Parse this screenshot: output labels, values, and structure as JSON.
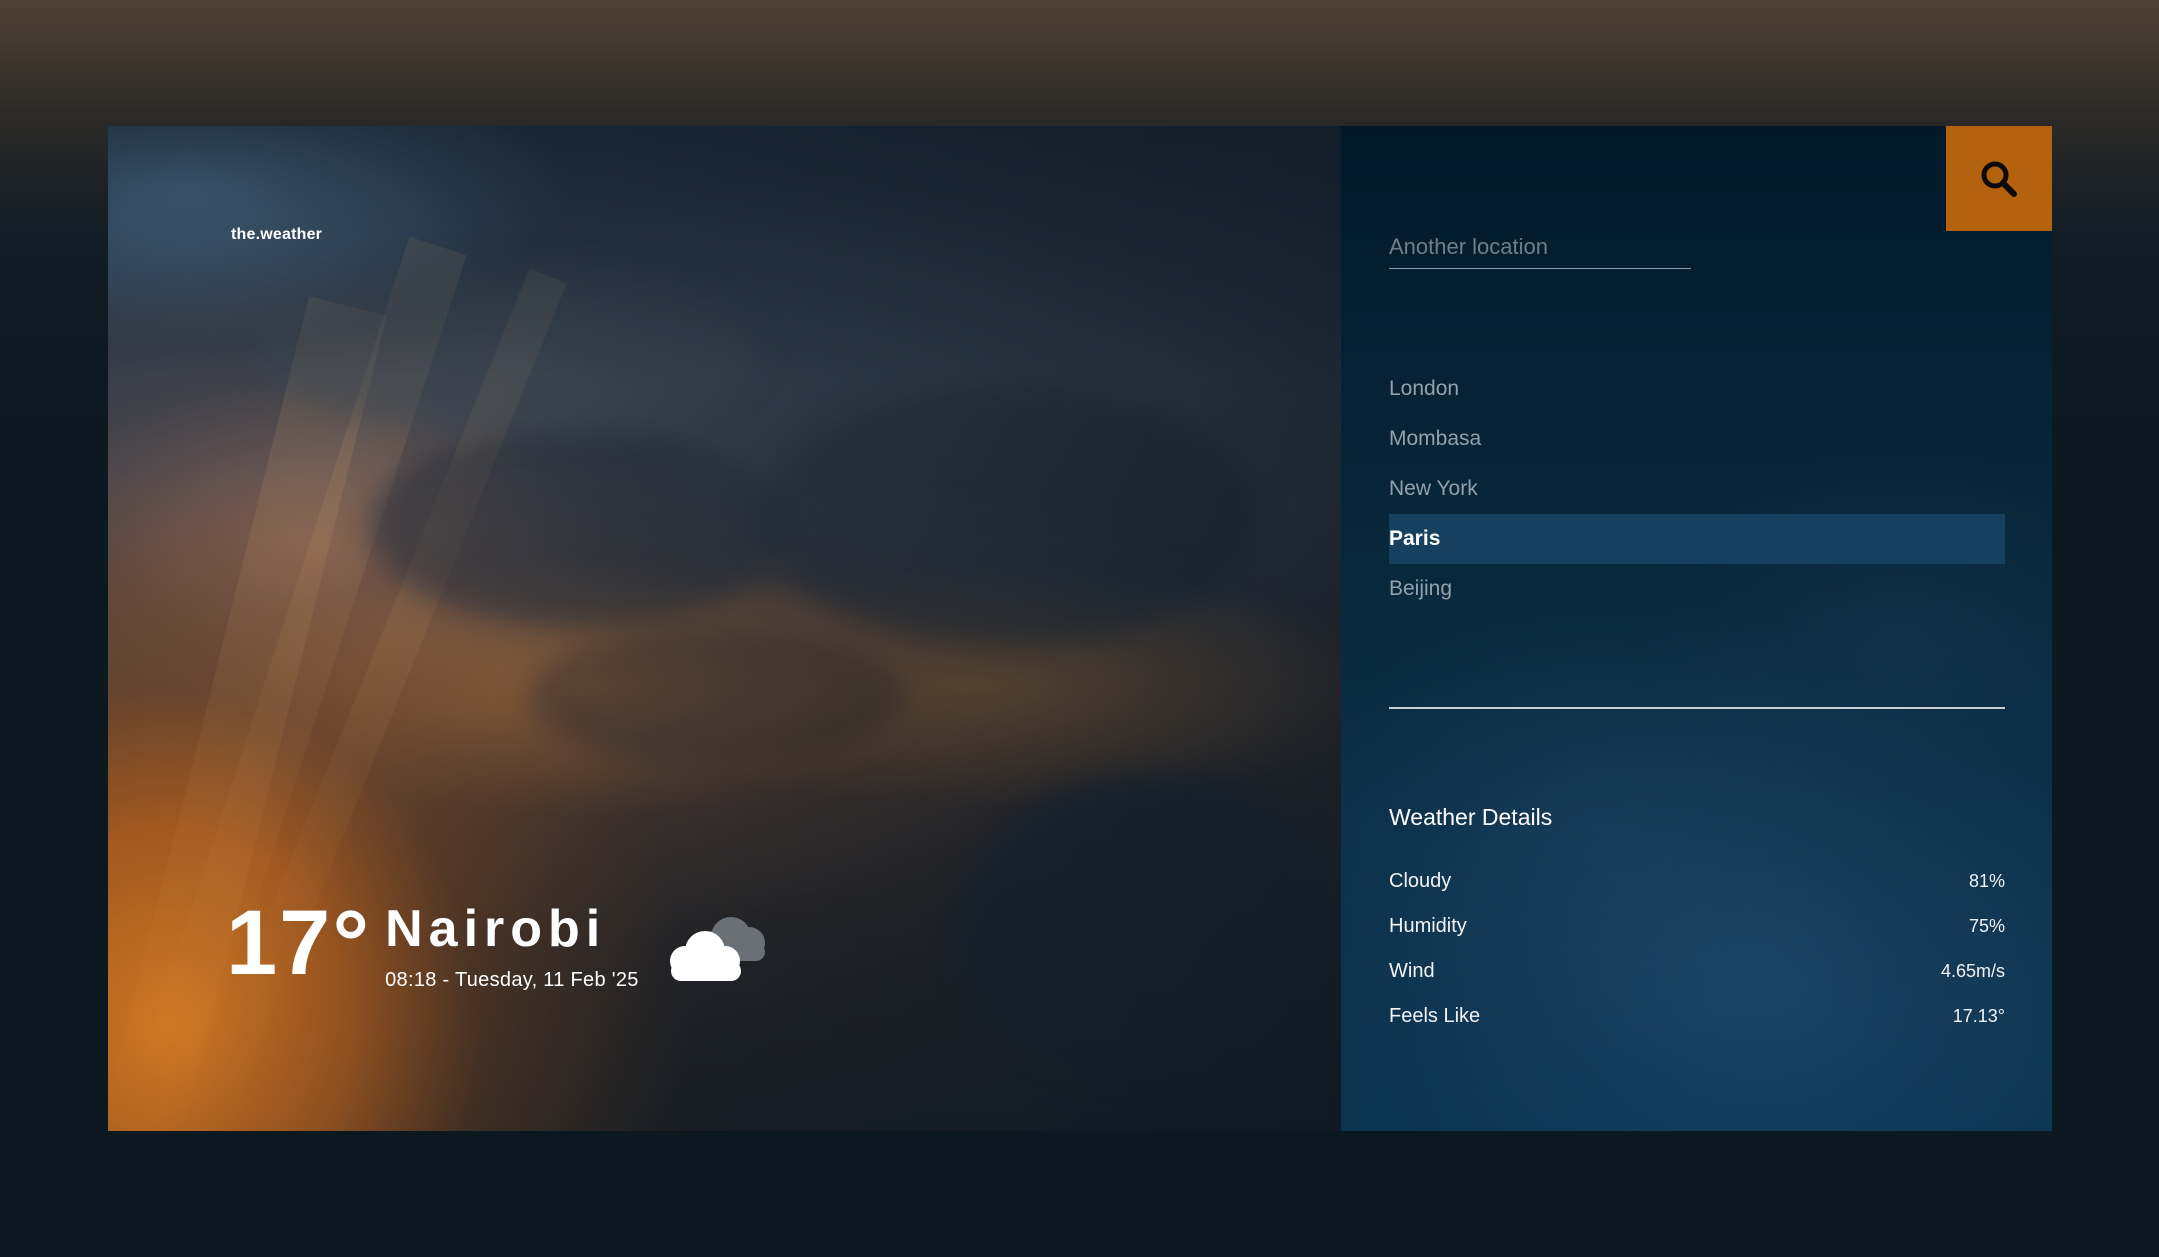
{
  "brand": "the.weather",
  "current": {
    "temperature": "17°",
    "city": "Nairobi",
    "datetime": "08:18 - Tuesday, 11 Feb '25",
    "condition_icon": "cloudy-icon"
  },
  "search": {
    "placeholder": "Another location",
    "value": "",
    "button_icon": "search-icon"
  },
  "locations": [
    {
      "label": "London"
    },
    {
      "label": "Mombasa"
    },
    {
      "label": "New York"
    },
    {
      "label": "Paris",
      "active": true
    },
    {
      "label": "Beijing"
    }
  ],
  "details": {
    "title": "Weather Details",
    "rows": [
      {
        "label": "Cloudy",
        "value": "81%"
      },
      {
        "label": "Humidity",
        "value": "75%"
      },
      {
        "label": "Wind",
        "value": "4.65m/s"
      },
      {
        "label": "Feels Like",
        "value": "17.13°"
      }
    ]
  },
  "colors": {
    "accent": "#b5620f",
    "panel": "#072538",
    "active_row": "#173f5e"
  }
}
